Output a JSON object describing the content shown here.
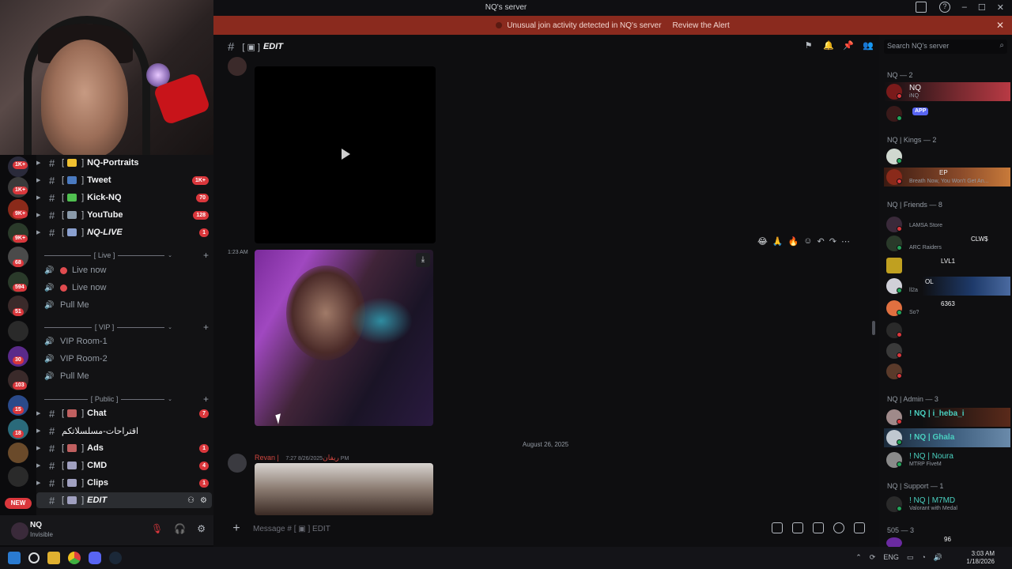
{
  "window": {
    "title": "NQ's server",
    "controls": [
      "–",
      "☐",
      "✕"
    ]
  },
  "alert": {
    "text": "Unusual join activity detected in NQ's server",
    "action": "Review the Alert"
  },
  "guild_badges": [
    "1K+",
    "1K+",
    "9K+",
    "9K+",
    "68",
    "594",
    "51",
    "30",
    "103",
    "15",
    "18"
  ],
  "new_label": "NEW",
  "channels": [
    {
      "name": "NQ-Portraits",
      "count": "",
      "italic": false,
      "emo_color": "#f0c030"
    },
    {
      "name": "Tweet",
      "count": "1K+",
      "italic": false,
      "emo_color": "#4a7ac0"
    },
    {
      "name": "Kick-NQ",
      "count": "70",
      "italic": false,
      "emo_color": "#50c050"
    },
    {
      "name": "YouTube",
      "count": "128",
      "italic": false,
      "emo_color": "#8a9aaa"
    },
    {
      "name": "NQ-LIVE",
      "count": "1",
      "italic": true,
      "emo_color": "#8aa0d0"
    }
  ],
  "categories": {
    "live": "Live",
    "vip": "VIP",
    "public": "Public"
  },
  "voice_live": [
    "Live now",
    "Live now",
    "Pull Me"
  ],
  "voice_vip": [
    "VIP Room-1",
    "VIP Room-2",
    "Pull Me"
  ],
  "public_channels": [
    {
      "name": "Chat",
      "count": "7",
      "emo_color": "#c06060"
    },
    {
      "name": "اقتراحات-مسلسلاتكم",
      "count": "",
      "emo_color": ""
    },
    {
      "name": "Ads",
      "count": "1",
      "emo_color": "#c06060"
    },
    {
      "name": "CMD",
      "count": "4",
      "emo_color": "#a0a0c0"
    },
    {
      "name": "Clips",
      "count": "1",
      "emo_color": "#a0a0c0"
    },
    {
      "name": "EDIT",
      "count": "",
      "emo_color": "#a0a0c0"
    }
  ],
  "user": {
    "name": "NQ",
    "status": "Invisible"
  },
  "channel_header": {
    "bracket": "[ ▣ ]",
    "title": "EDIT"
  },
  "messages": {
    "first_time": "1:23 AM",
    "divider": "August 26, 2025",
    "second_author": "Revan | ريفان",
    "second_meta": "8/26/2025 7:27 PM"
  },
  "composer": {
    "placeholder": "Message # [ ▣ ] EDIT"
  },
  "members": {
    "search_placeholder": "Search NQ's server",
    "groups": [
      {
        "title": "NQ — 2",
        "items": [
          {
            "name": "NQ",
            "sub": "iNQ",
            "tag": "",
            "status": "red",
            "banner": "banner"
          },
          {
            "name": "",
            "sub": "",
            "tag": "APP",
            "status": "green",
            "banner": ""
          }
        ]
      },
      {
        "title": "NQ | Kings — 2",
        "items": [
          {
            "name": "",
            "sub": "",
            "tag": "",
            "status": "green",
            "banner": ""
          },
          {
            "name": "EP",
            "sub": "Breath Now, You Won't Get An...",
            "tag": "",
            "status": "red",
            "banner": "banner2"
          }
        ]
      },
      {
        "title": "NQ | Friends — 8",
        "items": [
          {
            "name": "",
            "sub": "LAMSA Store",
            "tag": "",
            "status": "red",
            "banner": ""
          },
          {
            "name": "CLW$",
            "sub": "ARC Raiders",
            "tag": "",
            "status": "green",
            "banner": ""
          },
          {
            "name": "LVL1",
            "sub": "",
            "tag": "",
            "status": "red",
            "banner": ""
          },
          {
            "name": "OL",
            "sub": "ll2a",
            "tag": "",
            "status": "green",
            "banner": "banner3"
          },
          {
            "name": "6363",
            "sub": "So?",
            "tag": "",
            "status": "green",
            "banner": ""
          },
          {
            "name": "",
            "sub": "",
            "tag": "",
            "status": "red",
            "banner": ""
          },
          {
            "name": "",
            "sub": "",
            "tag": "",
            "status": "red",
            "banner": ""
          },
          {
            "name": "",
            "sub": "",
            "tag": "",
            "status": "red",
            "banner": ""
          }
        ]
      },
      {
        "title": "NQ | Admin — 3",
        "items": [
          {
            "name": "! NQ | i_heba_i",
            "sub": "",
            "tag": "",
            "status": "red",
            "banner": "banner4"
          },
          {
            "name": "! NQ | Ghala",
            "sub": "",
            "tag": "",
            "status": "green",
            "banner": "banner5"
          },
          {
            "name": "! NQ | Noura",
            "sub": "MTRP FiveM",
            "tag": "",
            "status": "green",
            "banner": ""
          }
        ]
      },
      {
        "title": "NQ | Support — 1",
        "items": [
          {
            "name": "! NQ | M7MD",
            "sub": "Valorant with Medal",
            "tag": "",
            "status": "green",
            "banner": ""
          }
        ]
      },
      {
        "title": "505 — 3",
        "items": [
          {
            "name": "96",
            "sub": "",
            "tag": "",
            "status": "red",
            "banner": ""
          }
        ]
      }
    ]
  },
  "taskbar": {
    "lang": "ENG",
    "time": "3:03 AM",
    "date": "1/18/2026"
  }
}
